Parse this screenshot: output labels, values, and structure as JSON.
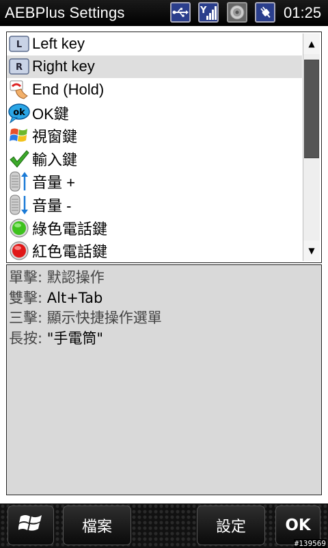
{
  "app_title": "AEBPlus Settings",
  "status_bar": {
    "icons": [
      "usb-icon",
      "signal-icon",
      "speaker-icon",
      "power-icon"
    ],
    "time": "01:25"
  },
  "key_list": {
    "selected_index": 1,
    "items": [
      {
        "icon": "left-key-icon",
        "label": "Left key"
      },
      {
        "icon": "right-key-icon",
        "label": "Right key"
      },
      {
        "icon": "end-call-icon",
        "label": "End (Hold)"
      },
      {
        "icon": "ok-key-icon",
        "label": "OK鍵"
      },
      {
        "icon": "windows-flag-icon",
        "label": "視窗鍵"
      },
      {
        "icon": "checkmark-icon",
        "label": "輸入鍵"
      },
      {
        "icon": "volume-up-icon",
        "label": "音量 +"
      },
      {
        "icon": "volume-down-icon",
        "label": "音量 -"
      },
      {
        "icon": "green-call-icon",
        "label": "綠色電話鍵"
      },
      {
        "icon": "red-call-icon",
        "label": "紅色電話鍵"
      }
    ]
  },
  "description": {
    "lines": [
      {
        "key": "單擊: ",
        "value": "默認操作"
      },
      {
        "key": "雙擊: ",
        "value": "Alt+Tab"
      },
      {
        "key": "三擊: ",
        "value": "顯示快捷操作選單"
      },
      {
        "key": "長按: ",
        "value": "\"手電筒\""
      }
    ]
  },
  "softkeys": {
    "start_icon": "windows-start-icon",
    "file_label": "檔案",
    "settings_label": "設定",
    "ok_label": "OK"
  },
  "watermark": "#139569",
  "colors": {
    "selection": "#dedede",
    "description_bg": "#d9d9d9",
    "status_icon_bg": "#2a3e8c"
  }
}
